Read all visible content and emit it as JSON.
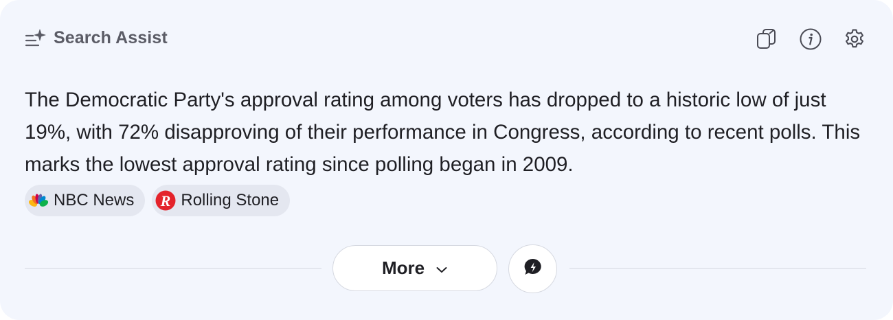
{
  "header": {
    "title": "Search Assist",
    "icons": [
      "search-assist-icon",
      "copy-icon",
      "info-icon",
      "settings-icon"
    ]
  },
  "summary": {
    "text": "The Democratic Party's approval rating among voters has dropped to a historic low of just 19%, with 72% disapproving of their performance in Congress, according to recent polls. This marks the lowest approval rating since polling began in 2009."
  },
  "sources": [
    {
      "name": "NBC News",
      "icon": "nbc-peacock-icon"
    },
    {
      "name": "Rolling Stone",
      "icon": "rolling-stone-icon",
      "icon_color": "#e4232b"
    }
  ],
  "actions": {
    "more_label": "More",
    "more_icon": "chevron-down-icon",
    "chat_icon": "chat-bubble-icon"
  },
  "colors": {
    "card_background": "#f3f6fd",
    "chip_background": "#e4e7f0",
    "text_primary": "#1f1f24",
    "text_secondary": "#5b5c66"
  }
}
